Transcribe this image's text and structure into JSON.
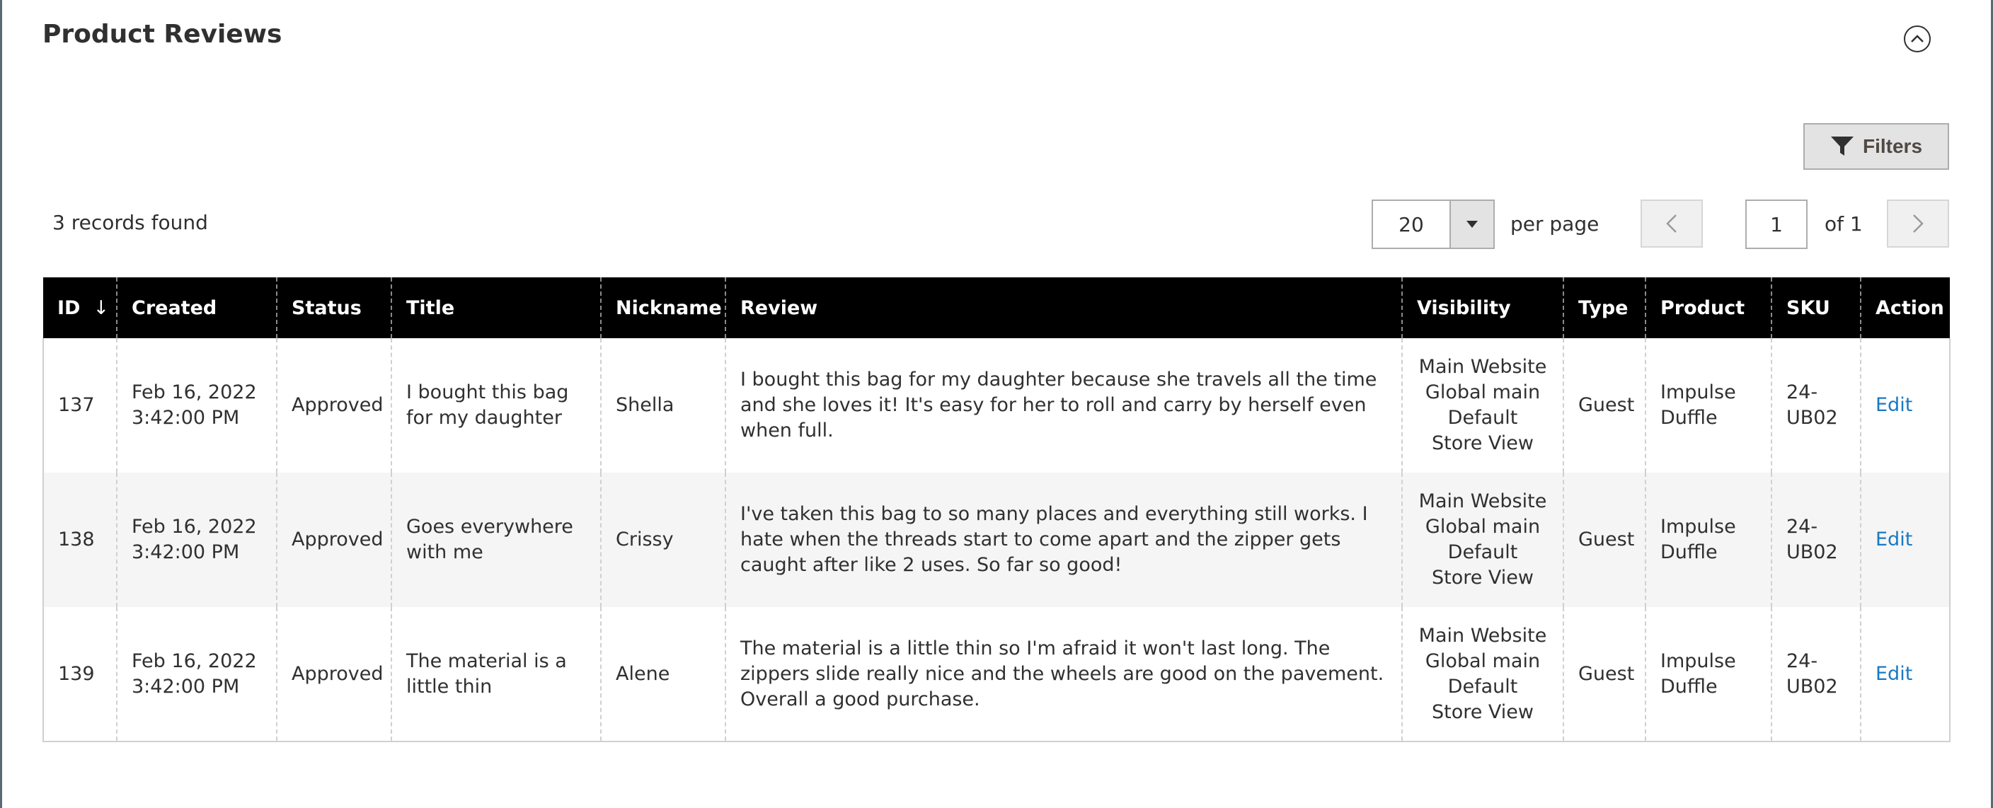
{
  "section": {
    "title": "Product Reviews",
    "collapse_icon": "chevron-up-circle-icon"
  },
  "toolbar": {
    "filters_label": "Filters",
    "filters_icon": "funnel-icon",
    "records_found": "3 records found",
    "per_page_value": "20",
    "per_page_label": "per page",
    "current_page": "1",
    "of_pages": "of 1"
  },
  "grid": {
    "columns": {
      "id": "ID",
      "id_sort": "↓",
      "created": "Created",
      "status": "Status",
      "title": "Title",
      "nickname": "Nickname",
      "review": "Review",
      "visibility": "Visibility",
      "type": "Type",
      "product": "Product",
      "sku": "SKU",
      "action": "Action"
    },
    "rows": [
      {
        "id": "137",
        "created_date": "Feb 16, 2022",
        "created_time": "3:42:00 PM",
        "status": "Approved",
        "title": "I bought this bag for my daughter",
        "nickname": "Shella",
        "review": "I bought this bag for my daughter because she travels all the time and she loves it! It's easy for her to roll and carry by herself even when full.",
        "visibility": [
          "Main Website",
          "Global main",
          "Default",
          "Store View"
        ],
        "type": "Guest",
        "product": "Impulse Duffle",
        "sku": "24-UB02",
        "action": "Edit"
      },
      {
        "id": "138",
        "created_date": "Feb 16, 2022",
        "created_time": "3:42:00 PM",
        "status": "Approved",
        "title": "Goes everywhere with me",
        "nickname": "Crissy",
        "review": "I've taken this bag to so many places and everything still works. I hate when the threads start to come apart and the zipper gets caught after like 2 uses. So far so good!",
        "visibility": [
          "Main Website",
          "Global main",
          "Default",
          "Store View"
        ],
        "type": "Guest",
        "product": "Impulse Duffle",
        "sku": "24-UB02",
        "action": "Edit"
      },
      {
        "id": "139",
        "created_date": "Feb 16, 2022",
        "created_time": "3:42:00 PM",
        "status": "Approved",
        "title": "The material is a little thin",
        "nickname": "Alene",
        "review": "The material is a little thin so I'm afraid it won't last long. The zippers slide really nice and the wheels are good on the pavement. Overall a good purchase.",
        "visibility": [
          "Main Website",
          "Global main",
          "Default",
          "Store View"
        ],
        "type": "Guest",
        "product": "Impulse Duffle",
        "sku": "24-UB02",
        "action": "Edit"
      }
    ]
  }
}
